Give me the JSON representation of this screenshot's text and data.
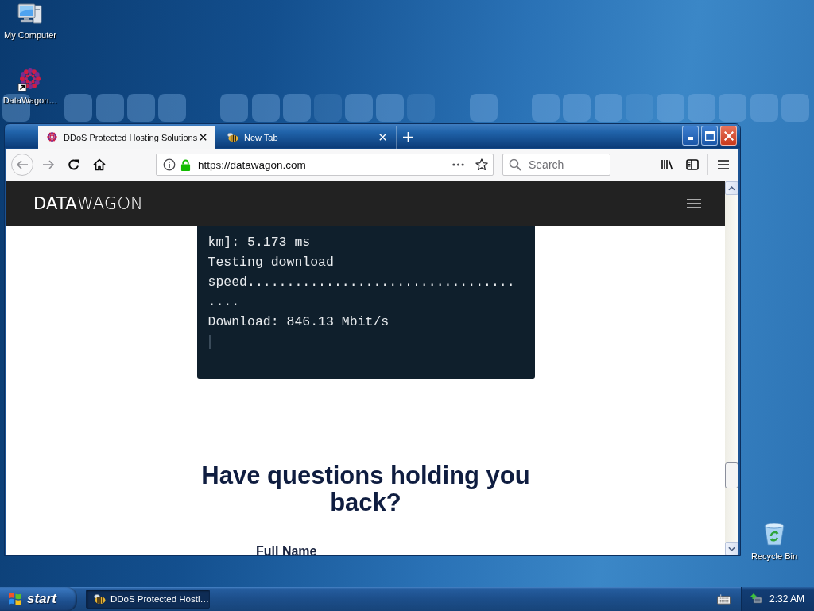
{
  "desktop": {
    "icons": [
      {
        "kind": "computer",
        "label": "My Computer"
      },
      {
        "kind": "shortcut",
        "label": "DataWagon…"
      },
      {
        "kind": "recycle",
        "label": "Recycle Bin"
      }
    ]
  },
  "browser": {
    "tabs": [
      {
        "kind": "site",
        "title": "DDoS Protected Hosting Solutions",
        "selected": true
      },
      {
        "kind": "blank",
        "title": "New Tab",
        "selected": false
      }
    ],
    "back": {
      "disabled": true
    },
    "forward": {
      "disabled": true
    },
    "url": "https://datawagon.com",
    "search": {
      "placeholder": "Search"
    }
  },
  "page": {
    "logo": "**DATA**WAGON",
    "terminal": {
      "lines": [
        "km]: 5.173 ms",
        "Testing download speed......................................",
        "Download: 846.13 Mbit/s"
      ]
    },
    "heading": "Have questions holding you back?",
    "form": {
      "fields": [
        {
          "label": "Full Name"
        }
      ]
    }
  },
  "taskbar": {
    "start": "start",
    "tasks": [
      {
        "label": "DDoS Protected Hosti…",
        "selected": true
      }
    ],
    "clock": "2:32 AM"
  }
}
